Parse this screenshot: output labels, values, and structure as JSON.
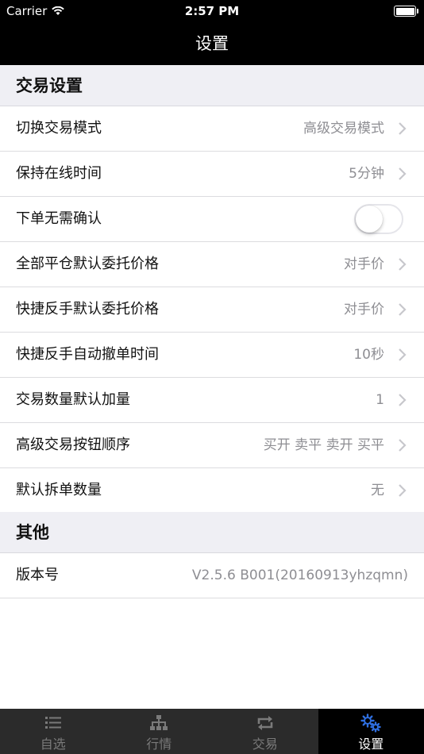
{
  "status_bar": {
    "carrier": "Carrier",
    "time": "2:57 PM"
  },
  "nav": {
    "title": "设置"
  },
  "sections": [
    {
      "title": "交易设置",
      "rows": [
        {
          "label": "切换交易模式",
          "value": "高级交易模式"
        },
        {
          "label": "保持在线时间",
          "value": "5分钟"
        },
        {
          "label": "下单无需确认",
          "toggle": false
        },
        {
          "label": "全部平仓默认委托价格",
          "value": "对手价"
        },
        {
          "label": "快捷反手默认委托价格",
          "value": "对手价"
        },
        {
          "label": "快捷反手自动撤单时间",
          "value": "10秒"
        },
        {
          "label": "交易数量默认加量",
          "value": "1"
        },
        {
          "label": "高级交易按钮顺序",
          "value": "买开 卖平 卖开 买平"
        },
        {
          "label": "默认拆单数量",
          "value": "无"
        }
      ]
    },
    {
      "title": "其他",
      "rows": [
        {
          "label": "版本号",
          "value": "V2.5.6 B001(20160913yhzqmn)"
        }
      ]
    }
  ],
  "tabs": [
    {
      "label": "自选",
      "icon": "list-icon",
      "active": false
    },
    {
      "label": "行情",
      "icon": "hierarchy-icon",
      "active": false
    },
    {
      "label": "交易",
      "icon": "swap-icon",
      "active": false
    },
    {
      "label": "设置",
      "icon": "gears-icon",
      "active": true
    }
  ],
  "colors": {
    "accent": "#2f6fe0",
    "section_bg": "#efeff4",
    "value_text": "#8e8e93"
  }
}
